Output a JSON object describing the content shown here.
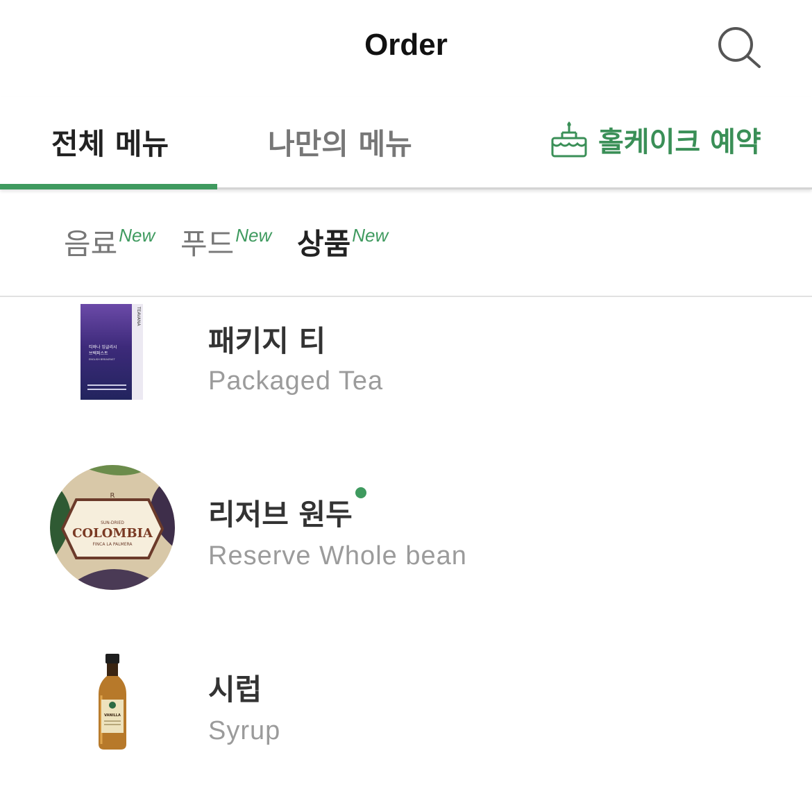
{
  "header": {
    "title": "Order",
    "search_icon": "search-icon"
  },
  "tabs": [
    {
      "label": "전체 메뉴",
      "active": true
    },
    {
      "label": "나만의 메뉴",
      "active": false
    },
    {
      "label": "홀케이크 예약",
      "icon": "cake-icon",
      "color": "#3a8f57"
    }
  ],
  "subtabs": [
    {
      "label": "음료",
      "badge": "New",
      "active": false
    },
    {
      "label": "푸드",
      "badge": "New",
      "active": false
    },
    {
      "label": "상품",
      "badge": "New",
      "active": true
    }
  ],
  "items": [
    {
      "name_ko": "패키지 티",
      "name_en": "Packaged Tea",
      "new_dot": false,
      "thumb_text": {
        "brand": "TEAVANA",
        "line1": "티바나 잉글리시",
        "line2": "브렉퍼스트",
        "line3": "ENGLISH BREAKFAST"
      }
    },
    {
      "name_ko": "리저브 원두",
      "name_en": "Reserve Whole bean",
      "new_dot": true,
      "thumb_text": {
        "top": "SUN-DRIED",
        "main": "COLOMBIA",
        "bottom": "FINCA LA PALMERA",
        "mark": "R"
      }
    },
    {
      "name_ko": "시럽",
      "name_en": "Syrup",
      "new_dot": false,
      "thumb_text": {
        "label": "VANILLA"
      }
    }
  ],
  "colors": {
    "accent": "#3f9a5f",
    "text_dark": "#222222",
    "text_muted": "#9b9b9b"
  }
}
